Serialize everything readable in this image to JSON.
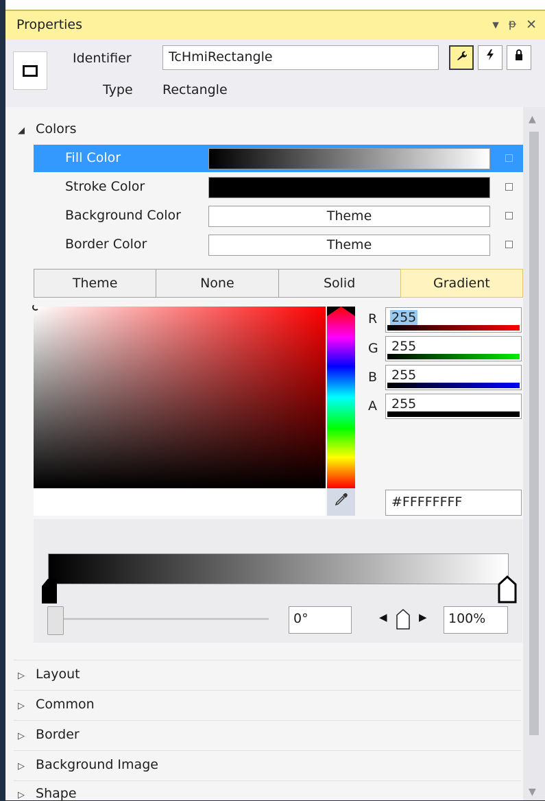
{
  "title_bar": {
    "title": "Properties",
    "dropdown_glyph": "▾",
    "pin_glyph": "ᚔ",
    "close_glyph": "✕"
  },
  "header": {
    "identifier_label": "Identifier",
    "identifier_value": "TcHmiRectangle",
    "type_label": "Type",
    "type_value": "Rectangle",
    "buttons": [
      {
        "name": "properties-wrench",
        "glyph": "🔧"
      },
      {
        "name": "events-lightning",
        "glyph": "ϟ"
      },
      {
        "name": "lock",
        "glyph": "🔒"
      }
    ]
  },
  "categories": {
    "colors": {
      "label": "Colors",
      "expanded_glyph": "◢"
    },
    "layout": {
      "label": "Layout",
      "glyph": "▷"
    },
    "common": {
      "label": "Common",
      "glyph": "▷"
    },
    "border": {
      "label": "Border",
      "glyph": "▷"
    },
    "background_image": {
      "label": "Background Image",
      "glyph": "▷"
    },
    "shape": {
      "label": "Shape",
      "glyph": "▷"
    }
  },
  "color_props": [
    {
      "name": "Fill Color",
      "value": "",
      "kind": "gradient",
      "selected": true
    },
    {
      "name": "Stroke Color",
      "value": "",
      "kind": "solid-black",
      "selected": false
    },
    {
      "name": "Background Color",
      "value": "Theme",
      "kind": "text",
      "selected": false
    },
    {
      "name": "Border Color",
      "value": "Theme",
      "kind": "text",
      "selected": false
    }
  ],
  "modes": {
    "theme": "Theme",
    "none": "None",
    "solid": "Solid",
    "gradient": "Gradient",
    "active": "Gradient"
  },
  "channels": {
    "r": {
      "label": "R",
      "value": "255",
      "color": "#ff0000"
    },
    "g": {
      "label": "G",
      "value": "255",
      "color": "#00cc00"
    },
    "b": {
      "label": "B",
      "value": "255",
      "color": "#0000ff"
    },
    "a": {
      "label": "A",
      "value": "255",
      "color": "#000000"
    }
  },
  "hex_value": "#FFFFFFFF",
  "gradient": {
    "angle": "0°",
    "stop_offset": "100%",
    "start_color": "#000000",
    "end_color": "#ffffff"
  },
  "colors": {
    "selected_row": "#3399ff",
    "title_bar": "#fff29d",
    "active_mode": "#fff3bf"
  }
}
